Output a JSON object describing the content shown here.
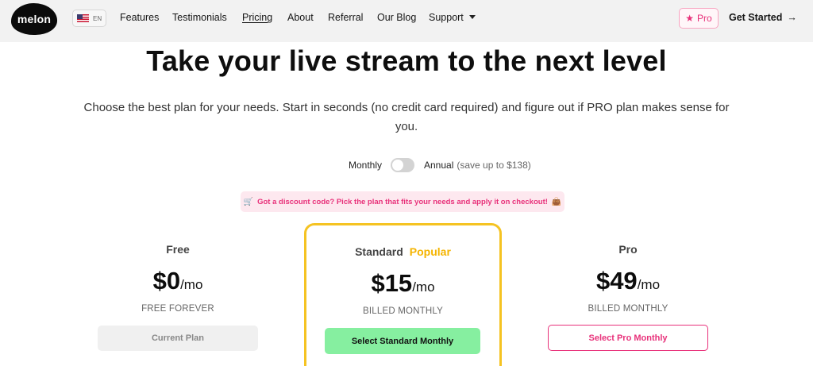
{
  "nav": {
    "logo": "melon",
    "language": "EN",
    "links": [
      "Features",
      "Testimonials",
      "Pricing",
      "About",
      "Referral",
      "Our Blog",
      "Support"
    ],
    "pro_label": "Pro",
    "get_started": "Get Started",
    "colors": {
      "pro_accent": "#e8317a",
      "bar_bg": "#f2f2f2"
    }
  },
  "hero": {
    "headline": "Take your live stream to the next level",
    "subtitle": "Choose the best plan for your needs. Start in seconds (no credit card required) and figure out if PRO plan makes sense for you."
  },
  "billing_toggle": {
    "monthly_label": "Monthly",
    "annual_label": "Annual",
    "annual_note": "(save up to $138)",
    "annual_selected": false
  },
  "discount_banner": {
    "text": "Got a discount code? Pick the plan that fits your needs and apply it on checkout!"
  },
  "plans": [
    {
      "name": "Free",
      "price": "$0",
      "period": "/mo",
      "billing": "FREE FOREVER",
      "button": "Current Plan"
    },
    {
      "name": "Standard",
      "badge": "Popular",
      "price": "$15",
      "period": "/mo",
      "billing": "BILLED MONTHLY",
      "button": "Select Standard Monthly"
    },
    {
      "name": "Pro",
      "price": "$49",
      "period": "/mo",
      "billing": "BILLED MONTHLY",
      "button": "Select Pro Monthly"
    }
  ],
  "colors": {
    "popular": "#f5b400",
    "standard_button": "#86efa0",
    "pro_button_border": "#e8317a"
  }
}
